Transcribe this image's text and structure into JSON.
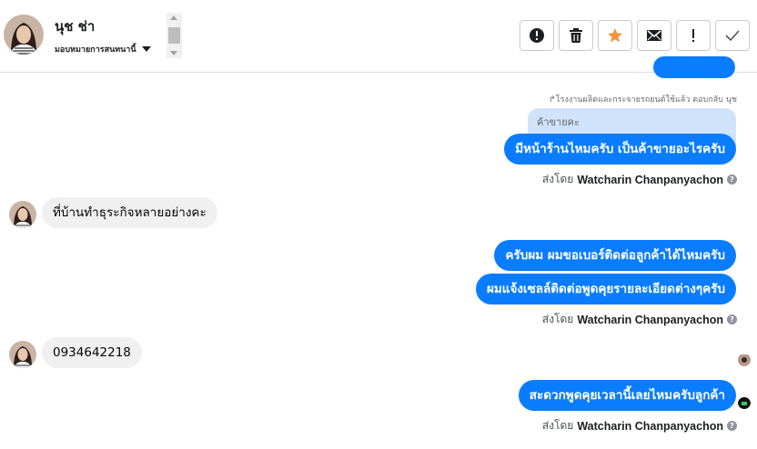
{
  "contact": {
    "name": "นุช ช่า",
    "assign_label": "มอบหมายการสนทนานี้"
  },
  "toolbar": {
    "buttons": [
      {
        "id": "spam",
        "icon": "alert-circle-icon"
      },
      {
        "id": "delete",
        "icon": "trash-icon"
      },
      {
        "id": "star",
        "icon": "star-icon",
        "color": "#f7923a"
      },
      {
        "id": "email",
        "icon": "envelope-icon"
      },
      {
        "id": "priority",
        "icon": "exclamation-icon"
      },
      {
        "id": "done",
        "icon": "checkmark-icon"
      }
    ]
  },
  "conversation": {
    "reply_note": "โรงงานผลิตและกระจายรถยนต์ใช้แล้ว ตอบกลับ นุช",
    "quoted_text": "ค้าขายคะ",
    "messages": [
      {
        "text": "มีหน้าร้านไหมครับ เป็นค้าขายอะไรครับ"
      },
      {
        "text": "ที่บ้านทำธุระกิจหลายอย่างคะ"
      },
      {
        "text": "ครับผม ผมขอเบอร์ติดต่อลูกค้าได้ไหมครับ"
      },
      {
        "text": "ผมแจ้งเซลล์ติดต่อพูดคุยรายละเอียดต่างๆครับ"
      },
      {
        "text": "0934642218"
      },
      {
        "text": "สะดวกพูดคุยเวลานี้เลยไหมครับลูกค้า"
      }
    ],
    "sent_by_prefix": "ส่งโดย",
    "sent_by_name": "Watcharin Chanpanyachon",
    "info_icon": "?"
  },
  "colors": {
    "outgoing_bubble": "#0a7cff",
    "incoming_bubble": "#f0f0f0",
    "quote_bubble": "#cfe3fb",
    "star_accent": "#f7923a"
  }
}
